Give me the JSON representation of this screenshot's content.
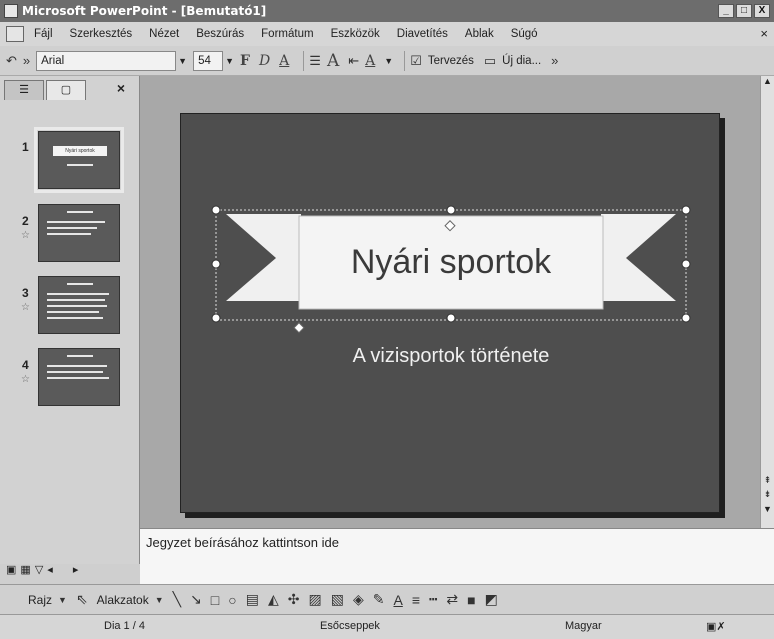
{
  "window": {
    "title": "Microsoft PowerPoint - [Bemutató1]",
    "minimize": "_",
    "maximize": "□",
    "close": "X"
  },
  "menu": {
    "items": [
      "Fájl",
      "Szerkesztés",
      "Nézet",
      "Beszúrás",
      "Formátum",
      "Eszközök",
      "Diavetítés",
      "Ablak",
      "Súgó"
    ],
    "close": "×"
  },
  "toolbar": {
    "undo": "↶",
    "more": "»",
    "font": "Arial",
    "size": "54",
    "bold": "F",
    "italic": "D",
    "underline": "A",
    "list": "☰",
    "grow": "A",
    "indent": "⇤",
    "font_color": "A",
    "design": "Tervezés",
    "new_slide": "Új dia...",
    "overflow": "»"
  },
  "panel": {
    "tab_outline": "☰",
    "tab_slides": "▢",
    "close": "×",
    "thumbnails": [
      {
        "number": "1",
        "title": "Nyári sportok"
      },
      {
        "number": "2",
        "star": "☆"
      },
      {
        "number": "3",
        "star": "☆"
      },
      {
        "number": "4",
        "star": "☆"
      }
    ]
  },
  "slide": {
    "title": "Nyári sportok",
    "subtitle": "A vizisportok története"
  },
  "notes": {
    "placeholder": "Jegyzet beírásához kattintson ide"
  },
  "drawing": {
    "draw": "Rajz",
    "autoshapes": "Alakzatok"
  },
  "status": {
    "slide": "Dia 1 / 4",
    "design": "Esőcseppek",
    "language": "Magyar"
  },
  "colors": {
    "slide_bg": "#4e4e4e",
    "banner": "#f0f0f0",
    "canvas": "#a8a8a8"
  }
}
